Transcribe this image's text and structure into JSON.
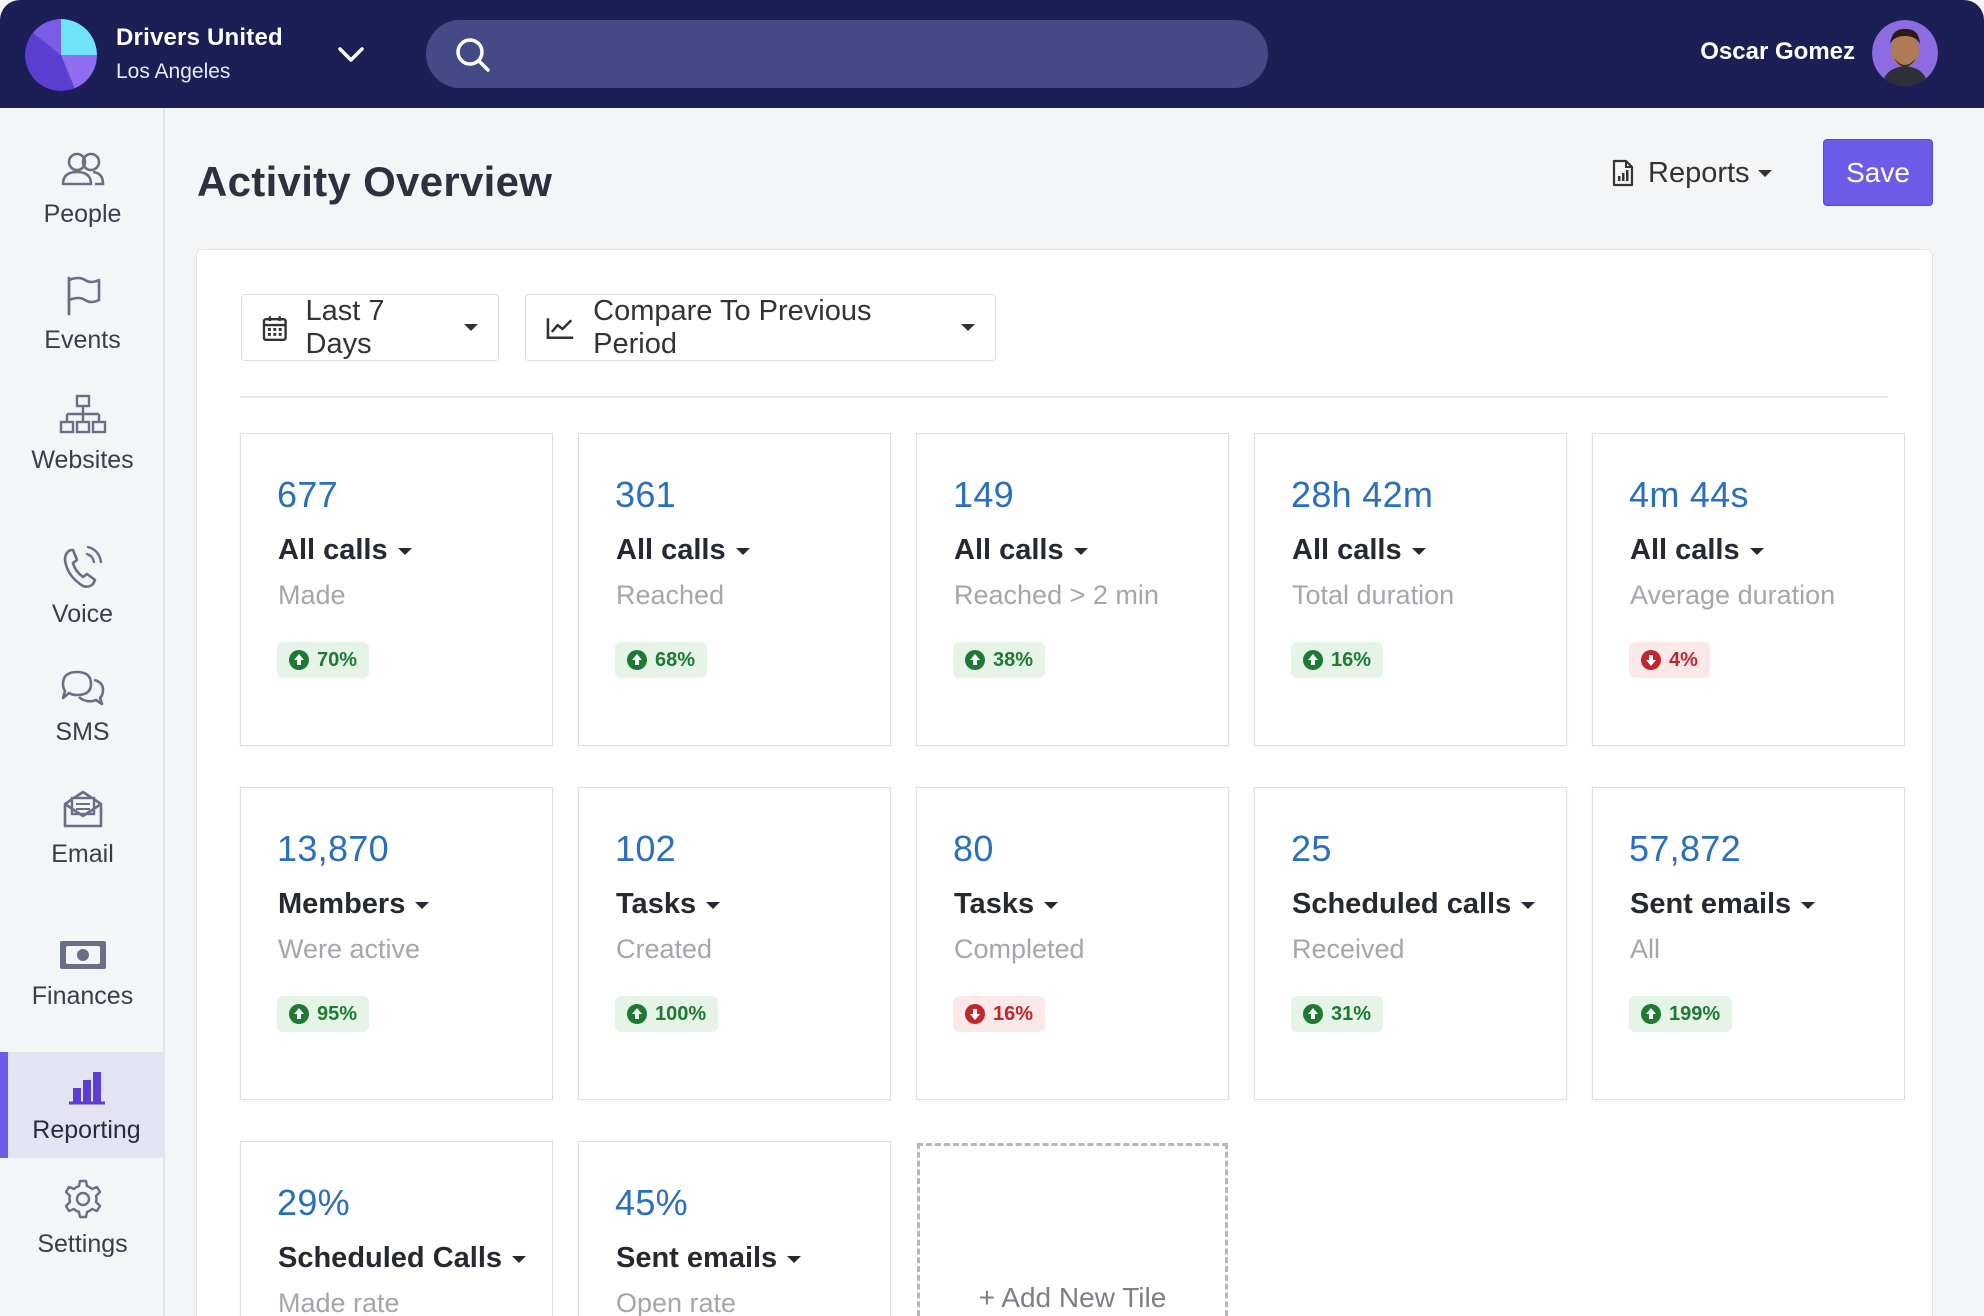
{
  "topbar": {
    "org_name": "Drivers United",
    "org_city": "Los Angeles",
    "search_placeholder": "",
    "user_name": "Oscar Gomez"
  },
  "sidebar": {
    "items": [
      {
        "label": "People",
        "icon": "people-icon"
      },
      {
        "label": "Events",
        "icon": "flag-icon"
      },
      {
        "label": "Websites",
        "icon": "sitemap-icon"
      },
      {
        "label": "Voice",
        "icon": "phone-icon"
      },
      {
        "label": "SMS",
        "icon": "chat-icon"
      },
      {
        "label": "Email",
        "icon": "email-icon"
      },
      {
        "label": "Finances",
        "icon": "money-icon"
      },
      {
        "label": "Reporting",
        "icon": "bar-chart-icon",
        "active": true
      },
      {
        "label": "Settings",
        "icon": "gear-icon"
      }
    ]
  },
  "header": {
    "title": "Activity Overview",
    "reports_label": "Reports",
    "save_label": "Save"
  },
  "filters": {
    "range_label": "Last 7 Days",
    "compare_label": "Compare To Previous Period"
  },
  "tiles": [
    {
      "value": "677",
      "metric": "All calls",
      "sub": "Made",
      "change": "70%",
      "trend": "up"
    },
    {
      "value": "361",
      "metric": "All calls",
      "sub": "Reached",
      "change": "68%",
      "trend": "up"
    },
    {
      "value": "149",
      "metric": "All calls",
      "sub": "Reached > 2 min",
      "change": "38%",
      "trend": "up"
    },
    {
      "value": "28h 42m",
      "metric": "All calls",
      "sub": "Total duration",
      "change": "16%",
      "trend": "up"
    },
    {
      "value": "4m 44s",
      "metric": "All calls",
      "sub": "Average duration",
      "change": "4%",
      "trend": "down"
    },
    {
      "value": "13,870",
      "metric": "Members",
      "sub": "Were active",
      "change": "95%",
      "trend": "up"
    },
    {
      "value": "102",
      "metric": "Tasks",
      "sub": "Created",
      "change": "100%",
      "trend": "up"
    },
    {
      "value": "80",
      "metric": "Tasks",
      "sub": "Completed",
      "change": "16%",
      "trend": "down"
    },
    {
      "value": "25",
      "metric": "Scheduled calls",
      "sub": "Received",
      "change": "31%",
      "trend": "up"
    },
    {
      "value": "57,872",
      "metric": "Sent emails",
      "sub": "All",
      "change": "199%",
      "trend": "up"
    },
    {
      "value": "29%",
      "metric": "Scheduled Calls",
      "sub": "Made rate",
      "change": "",
      "trend": ""
    },
    {
      "value": "45%",
      "metric": "Sent emails",
      "sub": "Open rate",
      "change": "",
      "trend": ""
    }
  ],
  "add_tile_label": "+ Add New Tile",
  "colors": {
    "topbar": "#1b1f56",
    "accent": "#6c5ce7",
    "value_blue": "#2a6fbd",
    "up_green": "#1e7a33",
    "down_red": "#c0262d"
  }
}
